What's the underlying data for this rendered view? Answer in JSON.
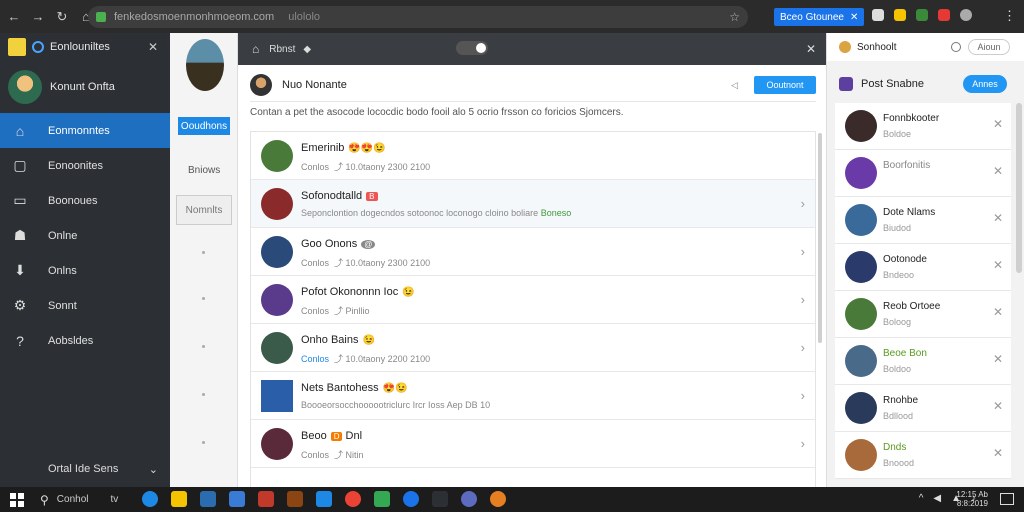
{
  "browser": {
    "url": "fenkedosmoenmonhmoeom.com",
    "url_suffix": "ulololo",
    "ext_tab_label": "Bceo Gtounee",
    "icons": [
      "back-arrow",
      "forward-arrow",
      "reload",
      "lock",
      "star",
      "menu"
    ]
  },
  "leftnav": {
    "app_title": "Eonlouniltes",
    "user_name": "Konunt Onfta",
    "items": [
      {
        "label": "Eonmonntes",
        "icon": "home-icon"
      },
      {
        "label": "Eonoonites",
        "icon": "bookmark-icon"
      },
      {
        "label": "Boonoues",
        "icon": "card-icon"
      },
      {
        "label": "Onlne",
        "icon": "users-icon"
      },
      {
        "label": "Onlns",
        "icon": "download-icon"
      },
      {
        "label": "Sonnt",
        "icon": "gear-icon"
      },
      {
        "label": "Aobsldes",
        "icon": "help-icon"
      }
    ],
    "footer_label": "Ortal Ide Sens"
  },
  "col2": {
    "button_label": "Ooudhons",
    "label1": "Bniows",
    "box_label": "Nomnlts"
  },
  "topbar": {
    "title": "Rbnst"
  },
  "main": {
    "channel_name": "Nuo Nonante",
    "channel_button": "Ooutnont",
    "notice": "Contan a pet the asocode lococdic bodo fooil alo 5 ocrio frsson co foricios Sjomcers.",
    "rows": [
      {
        "title": "Emerinib",
        "badge": "",
        "emoji": "😍😍😉",
        "sub": "Conlos",
        "time": "10.0taony 2300 2100",
        "avatar": "#4a7a3a"
      },
      {
        "title": "Sofonodtalld",
        "badge": "B",
        "emoji": "",
        "sub": "Seponclontion dogecndos sotoonoc loconogo cloino boliare",
        "sub_highlight": "Boneso",
        "avatar": "#8b2a2a"
      },
      {
        "title": "Goo Onons",
        "badge": "@",
        "emoji": "",
        "sub": "Conlos",
        "time": "10.0taony 2300 2100",
        "avatar": "#2a4a7a"
      },
      {
        "title": "Pofot Okononnn Ioc",
        "badge": "",
        "emoji": "😉",
        "sub": "Conlos",
        "time": "Pinllio",
        "avatar": "#5a3a8a"
      },
      {
        "title": "Onho Bains",
        "badge": "",
        "emoji": "😉",
        "sub": "Conlos",
        "time": "10.0taony 2200 2100",
        "avatar": "#3a5a4a"
      },
      {
        "title": "Nets Bantohess",
        "badge": "",
        "emoji": "😍😉",
        "sub": "Boooeorsocchoooootriclurc Ircr Ioss Aep DB 10",
        "avatar": "#2a5ea8"
      },
      {
        "title": "Beoo",
        "badge": "D",
        "badge_suffix": "Dnl",
        "emoji": "",
        "sub": "Conlos",
        "time": "Nitin",
        "avatar": "#5a2a3a"
      }
    ]
  },
  "right": {
    "header_label": "Sonhoolt",
    "header_button": "Aioun",
    "sub_label": "Post Snabne",
    "sub_button": "Annes",
    "rows": [
      {
        "name": "Fonnbkooter",
        "status": "Boldoe",
        "green": false,
        "color": "#3a2a2a"
      },
      {
        "name": "Boorfonitis",
        "status": "",
        "green": false,
        "color": "#6a3aa8"
      },
      {
        "name": "Dote Nlams",
        "status": "Biudod",
        "green": false,
        "color": "#3a6a9a"
      },
      {
        "name": "Ootonode",
        "status": "Bndeoo",
        "green": false,
        "color": "#2a3a6a"
      },
      {
        "name": "Reob Ortoee",
        "status": "Boloog",
        "green": false,
        "color": "#4a7a3a"
      },
      {
        "name": "Beoe Bon",
        "status": "Boldoo",
        "green": true,
        "color": "#4a6a8a"
      },
      {
        "name": "Rnohbe",
        "status": "Bdllood",
        "green": false,
        "color": "#2a3a5a"
      },
      {
        "name": "Dnds",
        "status": "Bnoood",
        "green": true,
        "color": "#a86a3a"
      }
    ]
  },
  "taskbar": {
    "search_label": "Conhol",
    "tv_label": "tv",
    "clock_time": "12:15 Ab",
    "clock_date": "8:8:2019"
  },
  "colors": {
    "accent": "#1e88e5",
    "nav_bg": "#2c2f33",
    "active_item": "#1e6fc0"
  }
}
